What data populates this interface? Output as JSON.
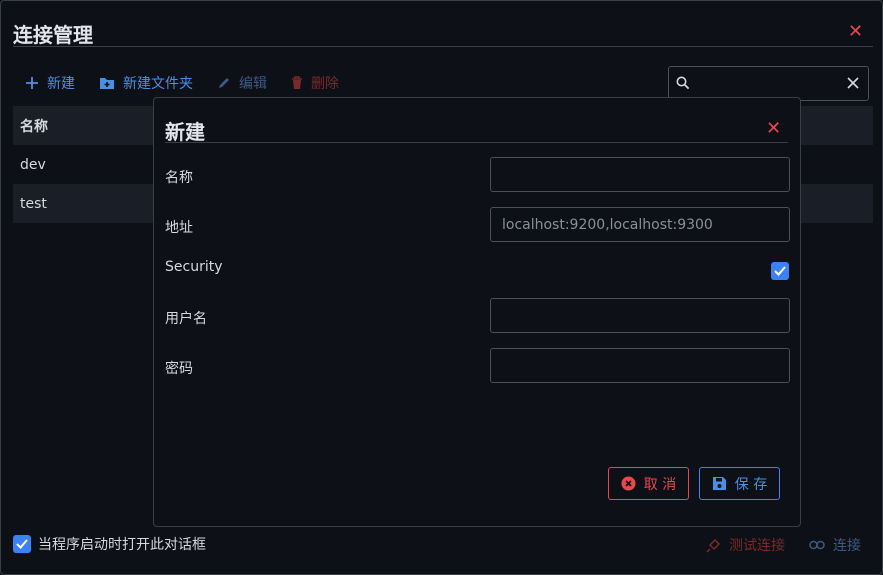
{
  "window": {
    "title": "连接管理"
  },
  "toolbar": {
    "new_label": "新建",
    "new_folder_label": "新建文件夹",
    "edit_label": "编辑",
    "delete_label": "删除"
  },
  "search": {
    "value": "",
    "placeholder": ""
  },
  "table": {
    "header": "名称",
    "rows": [
      "dev",
      "test"
    ]
  },
  "footer": {
    "open_on_start_label": "当程序启动时打开此对话框",
    "open_on_start_checked": true,
    "test_connection_label": "测试连接",
    "connect_label": "连接"
  },
  "dialog": {
    "title": "新建",
    "name_label": "名称",
    "name_value": "",
    "address_label": "地址",
    "address_placeholder": "localhost:9200,localhost:9300",
    "security_label": "Security",
    "security_checked": true,
    "username_label": "用户名",
    "username_value": "",
    "password_label": "密码",
    "password_value": "",
    "cancel_label": "取 消",
    "save_label": "保 存"
  },
  "colors": {
    "accent": "#3b82f6",
    "danger": "#e5484d",
    "background": "#0d1017",
    "row_alt": "#1a1e26"
  }
}
